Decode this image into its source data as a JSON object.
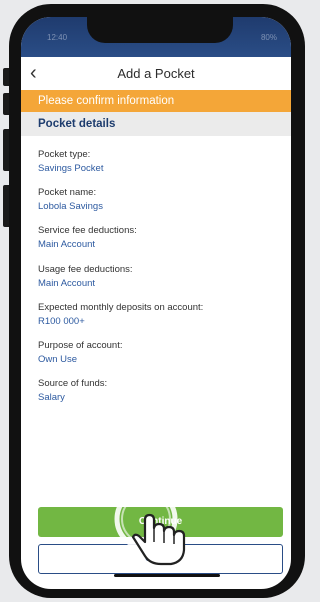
{
  "status_bar": {
    "time": "12:40",
    "battery": "80%"
  },
  "header": {
    "title": "Add a Pocket",
    "back_icon": "‹"
  },
  "banner": {
    "text": "Please confirm information"
  },
  "section": {
    "title": "Pocket details"
  },
  "fields": [
    {
      "label": "Pocket type:",
      "value": "Savings Pocket"
    },
    {
      "label": "Pocket name:",
      "value": "Lobola Savings"
    },
    {
      "label": "Service fee deductions:",
      "value": "Main Account"
    },
    {
      "label": "Usage fee deductions:",
      "value": "Main Account"
    },
    {
      "label": "Expected monthly deposits on account:",
      "value": "R100 000+"
    },
    {
      "label": "Purpose of account:",
      "value": "Own Use"
    },
    {
      "label": "Source of funds:",
      "value": "Salary"
    }
  ],
  "actions": {
    "continue_label": "Continue",
    "cancel_label": "Cancel"
  },
  "colors": {
    "banner": "#f4a638",
    "section_bg": "#ebebeb",
    "primary_button": "#72b743",
    "link_blue": "#2d5aa0",
    "navy": "#1d3c6e"
  }
}
